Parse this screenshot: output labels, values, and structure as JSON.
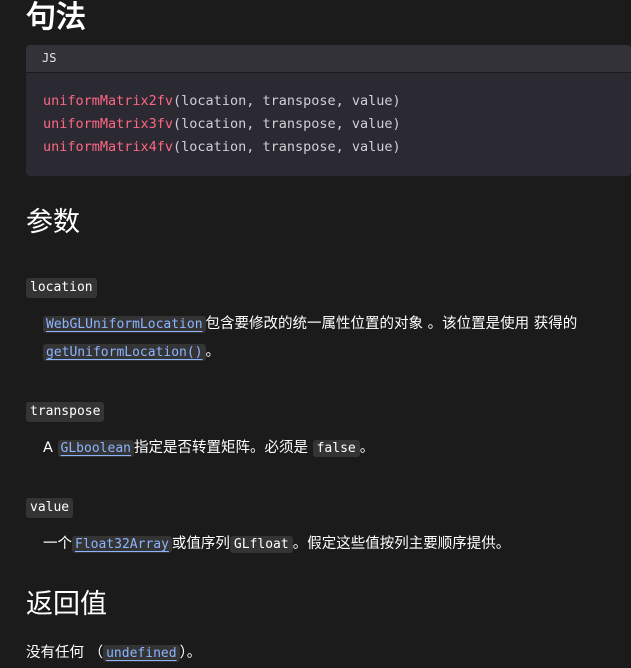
{
  "syntax": {
    "heading": "句法",
    "lang_label": "JS",
    "lines": [
      {
        "fn": "uniformMatrix2fv",
        "args": "(location, transpose, value)"
      },
      {
        "fn": "uniformMatrix3fv",
        "args": "(location, transpose, value)"
      },
      {
        "fn": "uniformMatrix4fv",
        "args": "(location, transpose, value)"
      }
    ]
  },
  "params": {
    "heading": "参数",
    "location": {
      "term": "location",
      "link1": "WebGLUniformLocation",
      "text1": "包含要修改的统一属性位置的对象 。该位置是使用 获得的",
      "link2": "getUniformLocation()",
      "text2": "。"
    },
    "transpose": {
      "term": "transpose",
      "prefix": "A ",
      "link": "GLboolean",
      "text1": "指定是否转置矩阵。必须是 ",
      "code": "false",
      "text2": "。"
    },
    "value": {
      "term": "value",
      "prefix": "一个",
      "link": "Float32Array",
      "text1": "或值序列",
      "code": "GLfloat",
      "text2": "。假定这些值按列主要顺序提供。"
    }
  },
  "returns": {
    "heading": "返回值",
    "prefix": "没有任何 （",
    "link": "undefined",
    "suffix": "）。"
  },
  "colors": {
    "background": "#1b1b1b",
    "code_bg": "#2b2a33",
    "function_name": "#ff6682",
    "link": "#8cb4ff"
  }
}
